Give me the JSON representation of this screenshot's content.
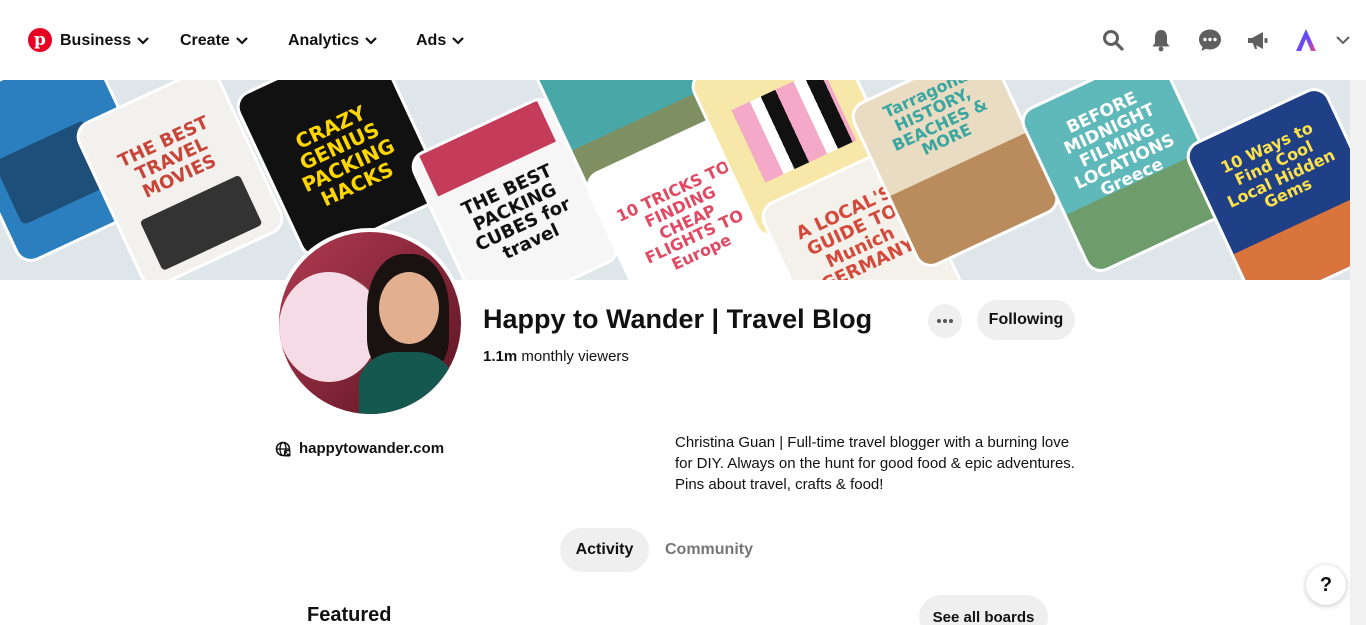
{
  "nav": {
    "logo_letter": "p",
    "items": [
      {
        "label": "Business"
      },
      {
        "label": "Create"
      },
      {
        "label": "Analytics"
      },
      {
        "label": "Ads"
      }
    ]
  },
  "banner": {
    "pins": [
      {
        "text": "THE BEST TRAVEL MOVIES",
        "bg": "#f3f1ee",
        "fg": "#c8453a"
      },
      {
        "text": "CRAZY GENIUS PACKING HACKS",
        "bg": "#111111",
        "fg": "#ffd600"
      },
      {
        "text": "THE BEST PACKING CUBES for travel",
        "bg": "#f6f6f6",
        "fg": "#111111"
      },
      {
        "text": "10 TRICKS TO FINDING CHEAP FLIGHTS TO Europe",
        "bg": "#ffffff",
        "fg": "#e04a63"
      },
      {
        "text": "A LOCAL'S GUIDE TO Munich GERMANY",
        "bg": "#f4f1ea",
        "fg": "#d3493b"
      },
      {
        "text": "Tarragona HISTORY, BEACHES & MORE",
        "bg": "#e9dcc3",
        "fg": "#3aa6a0"
      },
      {
        "text": "BEFORE MIDNIGHT FILMING LOCATIONS Greece",
        "bg": "#5fb8b9",
        "fg": "#ffffff"
      },
      {
        "text": "10 Ways to Find Cool Local Hidden Gems",
        "bg": "#1f3f86",
        "fg": "#ffe14a"
      }
    ]
  },
  "profile": {
    "name": "Happy to Wander | Travel Blog",
    "viewers_count": "1.1m",
    "viewers_label": "monthly viewers",
    "follow_label": "Following",
    "website": "happytowander.com",
    "bio": "Christina Guan | Full-time travel blogger with a burning love for DIY. Always on the hunt for good food & epic adventures. Pins about travel, crafts & food!"
  },
  "tabs": [
    {
      "label": "Activity",
      "active": true
    },
    {
      "label": "Community",
      "active": false
    }
  ],
  "featured": {
    "title": "Featured",
    "see_all_label": "See all boards"
  },
  "help": {
    "label": "?"
  },
  "colors": {
    "brand": "#e60023",
    "button_bg": "#efefef",
    "muted": "#767676"
  }
}
